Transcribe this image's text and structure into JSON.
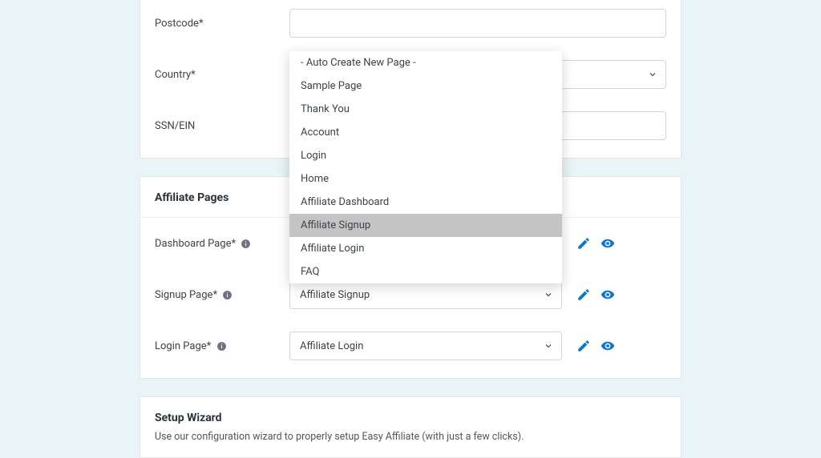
{
  "form": {
    "postcode": {
      "label": "Postcode*",
      "value": ""
    },
    "country": {
      "label": "Country*",
      "value": ""
    },
    "ssn": {
      "label": "SSN/EIN",
      "value": ""
    }
  },
  "dropdown": {
    "items": [
      "- Auto Create New Page -",
      "Sample Page",
      "Thank You",
      "Account",
      "Login",
      "Home",
      "Affiliate Dashboard",
      "Affiliate Signup",
      "Affiliate Login",
      "FAQ"
    ],
    "selected_index": 7
  },
  "pages": {
    "section_title": "Affiliate Pages",
    "dashboard": {
      "label": "Dashboard Page*",
      "value": ""
    },
    "signup": {
      "label": "Signup Page*",
      "value": "Affiliate Signup"
    },
    "login": {
      "label": "Login Page*",
      "value": "Affiliate Login"
    }
  },
  "wizard": {
    "title": "Setup Wizard",
    "description": "Use our configuration wizard to properly setup Easy Affiliate (with just a few clicks)."
  },
  "colors": {
    "icon_blue": "#0b78d0"
  }
}
